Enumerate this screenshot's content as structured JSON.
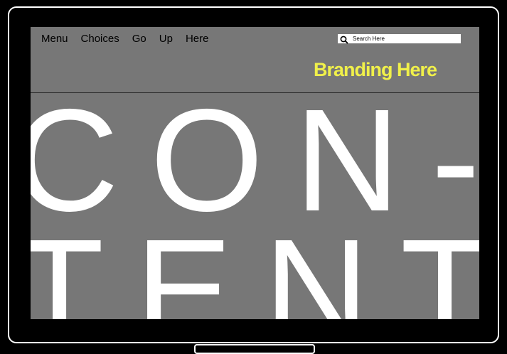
{
  "nav": {
    "items": [
      {
        "label": "Menu"
      },
      {
        "label": "Choices"
      },
      {
        "label": "Go"
      },
      {
        "label": "Up"
      },
      {
        "label": "Here"
      }
    ]
  },
  "search": {
    "placeholder": "Search Here",
    "icon": "search-icon"
  },
  "branding": {
    "text": "Branding Here",
    "color": "#f0f04a"
  },
  "hero": {
    "line1": "CON-",
    "line2": "TENT"
  },
  "colors": {
    "screen_bg": "#777777",
    "hero_text": "#ffffff",
    "bezel": "#000000"
  }
}
